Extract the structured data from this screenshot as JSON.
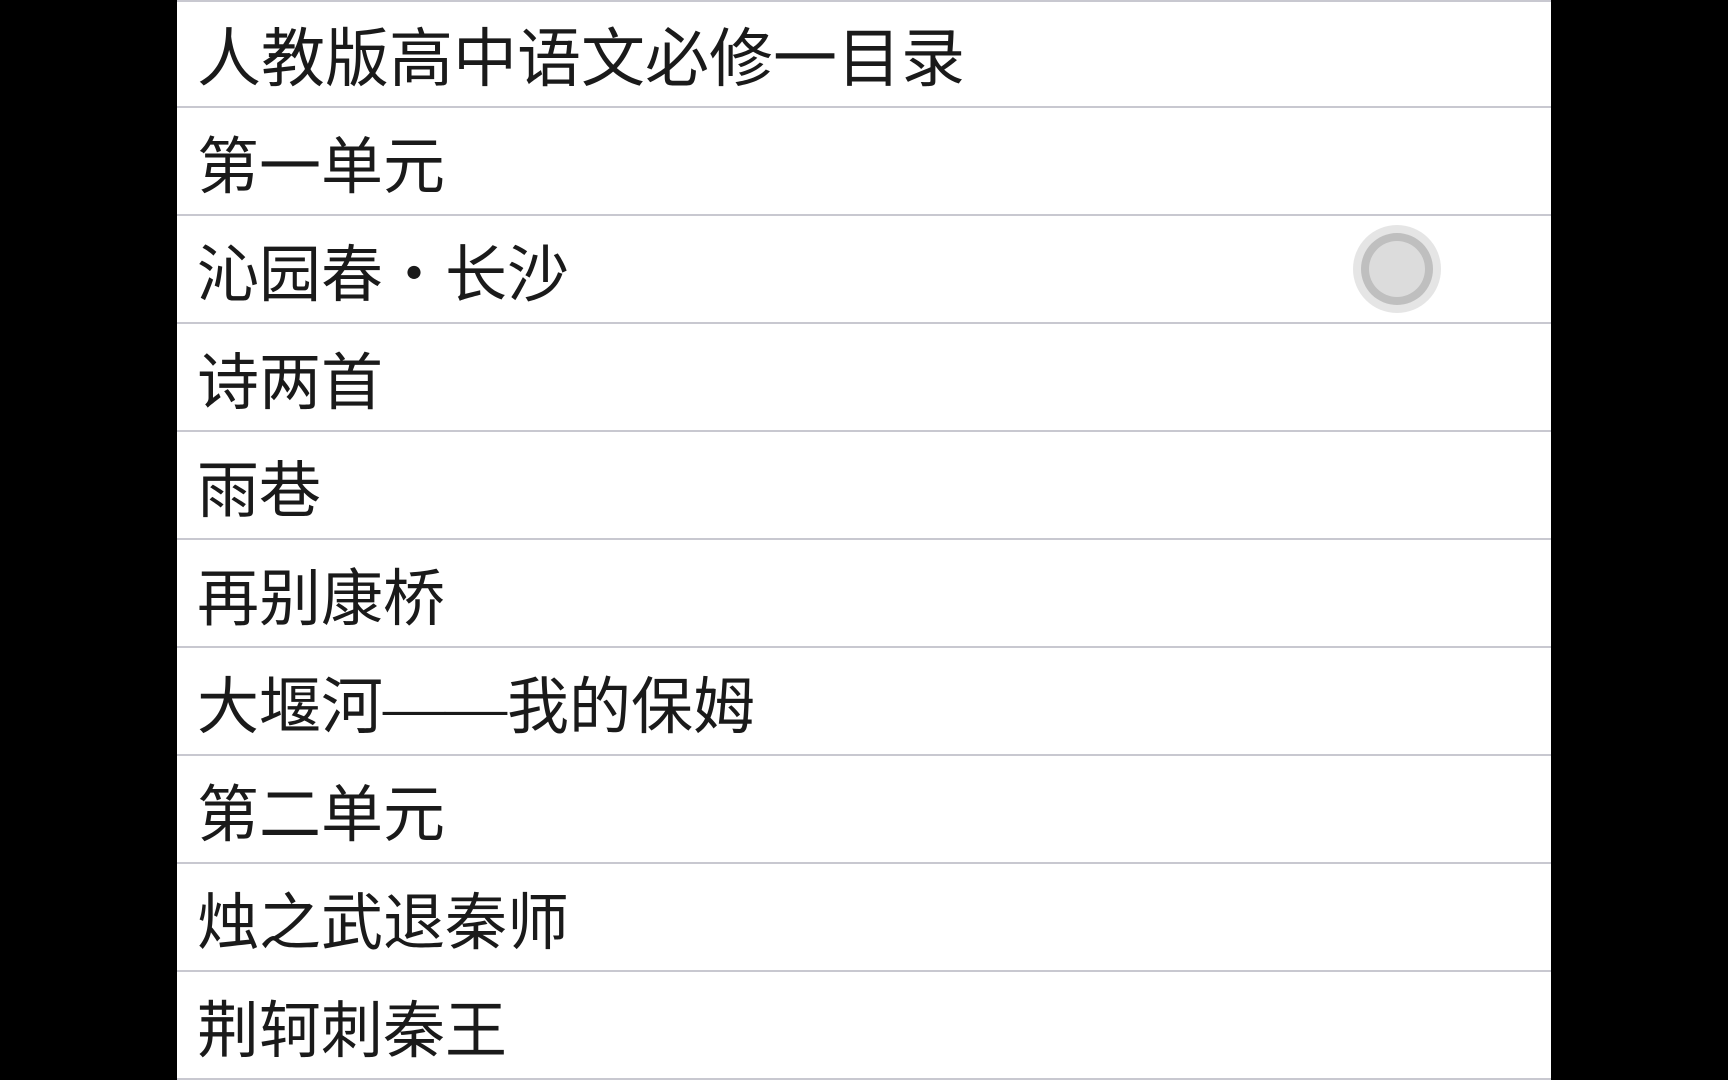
{
  "list": {
    "title": "人教版高中语文必修一目录",
    "items": [
      {
        "label": "第一单元"
      },
      {
        "label": "沁园春・长沙",
        "highlighted": true
      },
      {
        "label": "诗两首"
      },
      {
        "label": "雨巷"
      },
      {
        "label": "再别康桥"
      },
      {
        "label": "大堰河——我的保姆"
      },
      {
        "label": "第二单元"
      },
      {
        "label": "烛之武退秦师"
      },
      {
        "label": "荆轲刺秦王"
      }
    ]
  }
}
